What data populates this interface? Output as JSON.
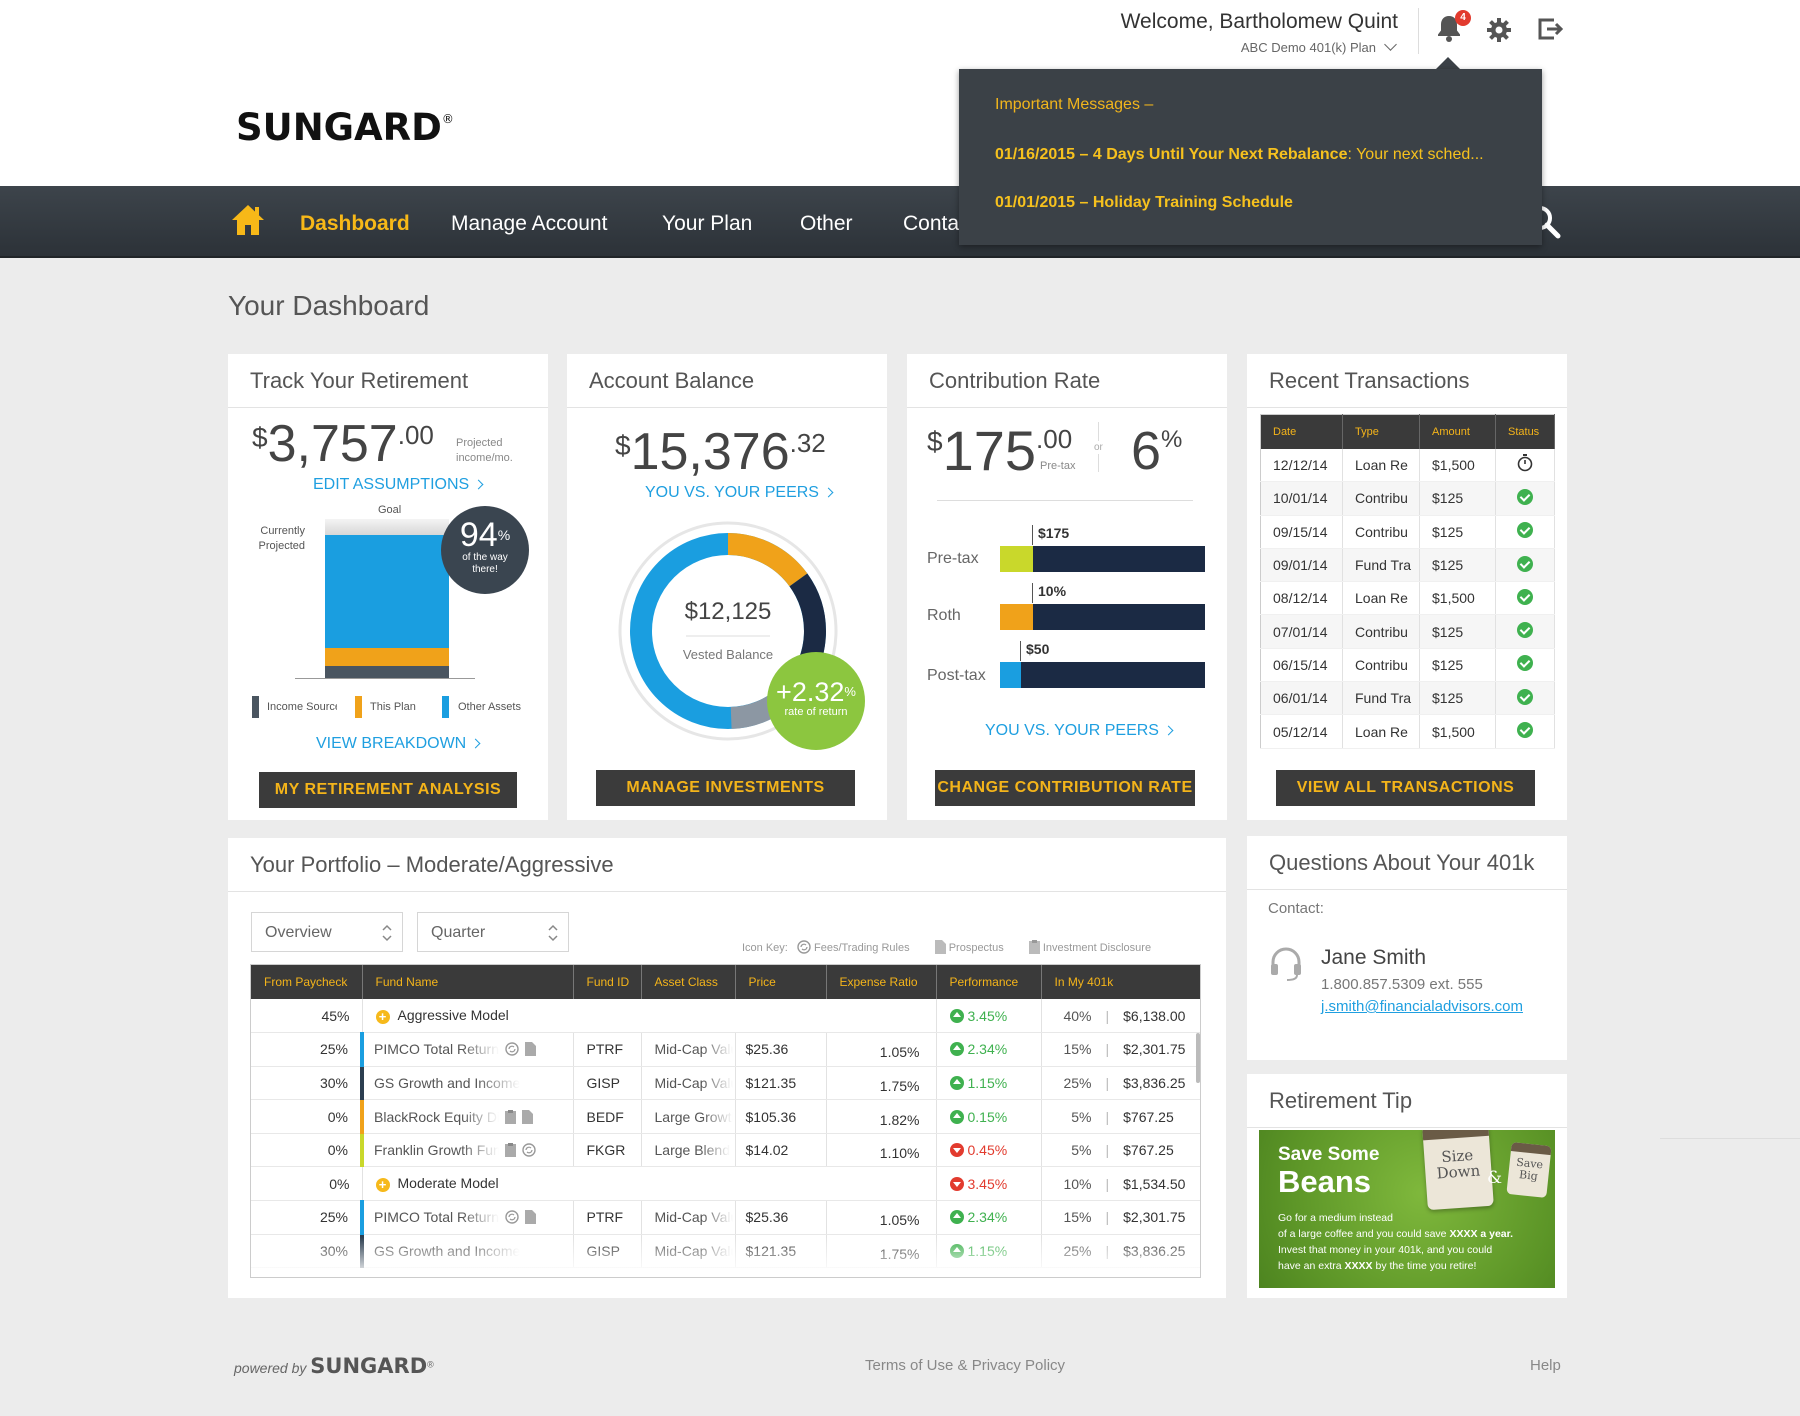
{
  "brand": {
    "logo": "SUNGARD",
    "reg": "®",
    "powered_by": "powered by"
  },
  "header": {
    "welcome": "Welcome, Bartholomew Quint",
    "plan": "ABC Demo 401(k) Plan",
    "notification_count": "4",
    "icons": [
      "bell-icon",
      "gear-icon",
      "logout-icon"
    ]
  },
  "notifications": {
    "title": "Important Messages –",
    "messages": [
      {
        "date_title": "01/16/2015 – 4 Days Until Your Next Rebalance",
        "body": ": Your next sched..."
      },
      {
        "date_title": "01/01/2015 – Holiday Training Schedule",
        "body": ""
      }
    ]
  },
  "nav": {
    "items": [
      "Dashboard",
      "Manage Account",
      "Your Plan",
      "Other",
      "Contact Us"
    ],
    "active": "Dashboard"
  },
  "page_title": "Your Dashboard",
  "track": {
    "title": "Track Your Retirement",
    "currency": "$",
    "amount": "3,757",
    "cents": ".00",
    "amount_note": "Projected income/mo.",
    "edit_link": "EDIT ASSUMPTIONS",
    "goal_label": "Goal",
    "current_label": "Currently Projected",
    "percent": "94",
    "percent_sign": "%",
    "percent_note": "of the way there!",
    "legend": [
      "Income Source",
      "This Plan",
      "Other Assets"
    ],
    "legend_colors": [
      "#4a5560",
      "#f0a21a",
      "#1a9ee0"
    ],
    "breakdown_link": "VIEW BREAKDOWN",
    "button": "MY RETIREMENT ANALYSIS"
  },
  "balance": {
    "title": "Account Balance",
    "currency": "$",
    "amount": "15,376",
    "cents": ".32",
    "peers_link": "YOU VS. YOUR PEERS",
    "vested_amount": "$12,125",
    "vested_label": "Vested Balance",
    "return_value": "+2.32",
    "return_sign": "%",
    "return_label": "rate of return",
    "button": "MANAGE INVESTMENTS"
  },
  "contribution": {
    "title": "Contribution Rate",
    "currency": "$",
    "amount": "175",
    "cents": ".00",
    "amount_note": "Pre-tax",
    "or": "or",
    "percent": "6",
    "percent_sign": "%",
    "bars": [
      {
        "label": "Pre-tax",
        "value_label": "$175",
        "color": "#c9d82b",
        "fill": 0.16
      },
      {
        "label": "Roth",
        "value_label": "10%",
        "color": "#f0a21a",
        "fill": 0.16
      },
      {
        "label": "Post-tax",
        "value_label": "$50",
        "color": "#1a9ee0",
        "fill": 0.1
      }
    ],
    "peers_link": "YOU VS. YOUR PEERS",
    "button": "CHANGE CONTRIBUTION RATE"
  },
  "transactions": {
    "title": "Recent Transactions",
    "columns": [
      "Date",
      "Type",
      "Amount",
      "Status"
    ],
    "rows": [
      {
        "date": "12/12/14",
        "type": "Loan Re",
        "amount": "$1,500",
        "status": "pending"
      },
      {
        "date": "10/01/14",
        "type": "Contribu",
        "amount": "$125",
        "status": "complete"
      },
      {
        "date": "09/15/14",
        "type": "Contribu",
        "amount": "$125",
        "status": "complete"
      },
      {
        "date": "09/01/14",
        "type": "Fund Tra",
        "amount": "$125",
        "status": "complete"
      },
      {
        "date": "08/12/14",
        "type": "Loan Re",
        "amount": "$1,500",
        "status": "complete"
      },
      {
        "date": "07/01/14",
        "type": "Contribu",
        "amount": "$125",
        "status": "complete"
      },
      {
        "date": "06/15/14",
        "type": "Contribu",
        "amount": "$125",
        "status": "complete"
      },
      {
        "date": "06/01/14",
        "type": "Fund Tra",
        "amount": "$125",
        "status": "complete"
      },
      {
        "date": "05/12/14",
        "type": "Loan Re",
        "amount": "$1,500",
        "status": "complete"
      }
    ],
    "button": "VIEW ALL TRANSACTIONS"
  },
  "portfolio": {
    "title": "Your Portfolio – Moderate/Aggressive",
    "select_view": "Overview",
    "select_period": "Quarter",
    "icon_key_label": "Icon Key:",
    "icon_key": [
      "Fees/Trading Rules",
      "Prospectus",
      "Investment Disclosure"
    ],
    "columns": [
      "From Paycheck",
      "Fund Name",
      "Fund ID",
      "Asset Class",
      "Price",
      "Expense Ratio",
      "Performance",
      "In My 401k"
    ],
    "rows": [
      {
        "kind": "group",
        "paycheck": "45%",
        "name": "Aggressive Model",
        "perf": "3.45%",
        "dir": "up",
        "pct": "40%",
        "value": "$6,138.00"
      },
      {
        "kind": "fund",
        "paycheck": "25%",
        "name": "PIMCO Total Return Fund",
        "color": "#1a9ee0",
        "icons": [
          "fees-icon",
          "prospectus-icon"
        ],
        "id": "PTRF",
        "asset": "Mid-Cap Value",
        "price": "$25.36",
        "expense": "1.05%",
        "perf": "2.34%",
        "dir": "up",
        "pct": "15%",
        "value": "$2,301.75"
      },
      {
        "kind": "fund",
        "paycheck": "30%",
        "name": "GS Growth and Income",
        "color": "#2c3e50",
        "icons": [],
        "id": "GISP",
        "asset": "Mid-Cap Value",
        "price": "$121.35",
        "expense": "1.75%",
        "perf": "1.15%",
        "dir": "up",
        "pct": "25%",
        "value": "$3,836.25"
      },
      {
        "kind": "fund",
        "paycheck": "0%",
        "name": "BlackRock Equity Dividend",
        "color": "#f0a21a",
        "icons": [
          "disclosure-icon",
          "prospectus-icon"
        ],
        "id": "BEDF",
        "asset": "Large Growth",
        "price": "$105.36",
        "expense": "1.82%",
        "perf": "0.15%",
        "dir": "up",
        "pct": "5%",
        "value": "$767.25"
      },
      {
        "kind": "fund",
        "paycheck": "0%",
        "name": "Franklin Growth Fund",
        "color": "#c9d82b",
        "icons": [
          "disclosure-icon",
          "fees-icon"
        ],
        "id": "FKGR",
        "asset": "Large Blend",
        "price": "$14.02",
        "expense": "1.10%",
        "perf": "0.45%",
        "dir": "down",
        "pct": "5%",
        "value": "$767.25"
      },
      {
        "kind": "group",
        "paycheck": "0%",
        "name": "Moderate Model",
        "perf": "3.45%",
        "dir": "down",
        "pct": "10%",
        "value": "$1,534.50"
      },
      {
        "kind": "fund",
        "paycheck": "25%",
        "name": "PIMCO Total Return Fund",
        "color": "#1a9ee0",
        "icons": [
          "fees-icon",
          "prospectus-icon"
        ],
        "id": "PTRF",
        "asset": "Mid-Cap Value",
        "price": "$25.36",
        "expense": "1.05%",
        "perf": "2.34%",
        "dir": "up",
        "pct": "15%",
        "value": "$2,301.75"
      },
      {
        "kind": "fund",
        "paycheck": "30%",
        "name": "GS Growth and Income",
        "color": "#2c3e50",
        "icons": [],
        "id": "GISP",
        "asset": "Mid-Cap Value",
        "price": "$121.35",
        "expense": "1.75%",
        "perf": "1.15%",
        "dir": "up",
        "pct": "25%",
        "value": "$3,836.25"
      }
    ]
  },
  "questions": {
    "title": "Questions About Your 401k",
    "contact_label": "Contact:",
    "name": "Jane Smith",
    "phone": "1.800.857.5309 ext. 555",
    "email": "j.smith@financialadvisors.com"
  },
  "tip": {
    "title": "Retirement Tip",
    "headline1": "Save Some",
    "headline2": "Beans",
    "cup1_a": "Size",
    "cup1_b": "Down",
    "amp": "&",
    "cup2_a": "Save",
    "cup2_b": "Big",
    "body_1": "Go for a medium instead",
    "body_2": "of a large coffee and you could save ",
    "body_bold1": "XXXX a year.",
    "body_3": "Invest that money in your 401k, and you could",
    "body_4": "have an extra ",
    "body_bold2": "XXXX",
    "body_5": " by the time you retire!"
  },
  "footer": {
    "links": [
      "Terms of Use & Privacy Policy",
      "Help"
    ]
  }
}
